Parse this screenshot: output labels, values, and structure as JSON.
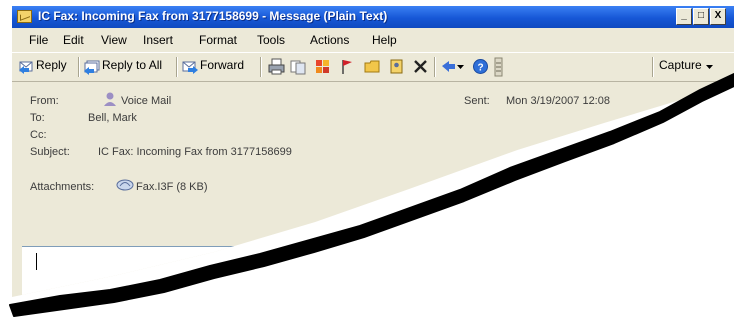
{
  "window": {
    "title": "IC Fax: Incoming Fax from 3177158699 - Message (Plain Text)",
    "minimize_glyph": "_",
    "maximize_glyph": "□",
    "close_glyph": "X"
  },
  "menu": {
    "file": "File",
    "edit": "Edit",
    "view": "View",
    "insert": "Insert",
    "format": "Format",
    "tools": "Tools",
    "actions": "Actions",
    "help": "Help"
  },
  "toolbar": {
    "reply": "Reply",
    "reply_all": "Reply to All",
    "forward": "Forward",
    "capture": "Capture"
  },
  "message": {
    "from_label": "From:",
    "from_value": "Voice Mail",
    "sent_label": "Sent:",
    "sent_value": "Mon 3/19/2007 12:08",
    "to_label": "To:",
    "to_value": "Bell, Mark",
    "cc_label": "Cc:",
    "cc_value": "",
    "subject_label": "Subject:",
    "subject_value": "IC Fax: Incoming Fax from 3177158699",
    "attachments_label": "Attachments:",
    "attachment_name": "Fax.I3F (8 KB)"
  },
  "colors": {
    "titlebar": "#1657d6",
    "window_face": "#ece9d8"
  }
}
